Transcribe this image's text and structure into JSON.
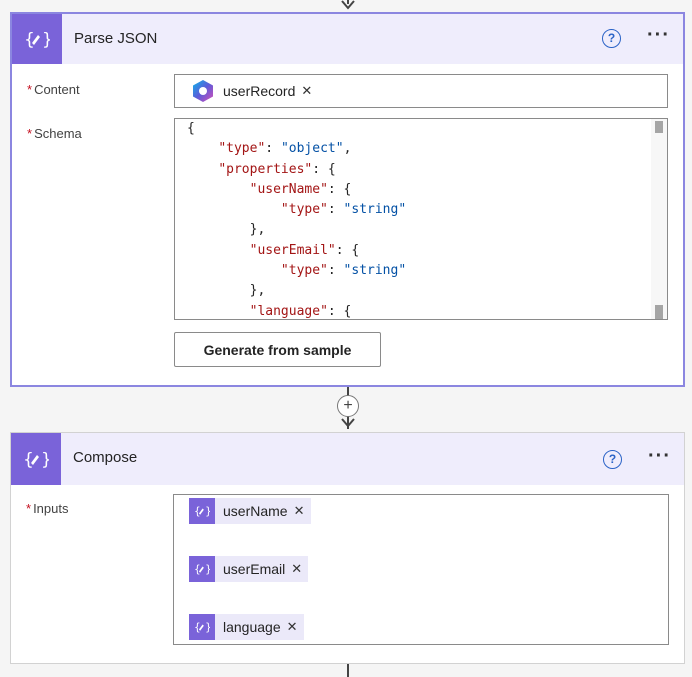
{
  "parse_json": {
    "title": "Parse JSON",
    "help": "?",
    "more": "···",
    "content_label": "Content",
    "content_token": "userRecord",
    "schema_label": "Schema",
    "schema_lines": [
      [
        {
          "t": "p",
          "v": "{"
        }
      ],
      [
        {
          "t": "p",
          "v": "    "
        },
        {
          "t": "k",
          "v": "\"type\""
        },
        {
          "t": "p",
          "v": ": "
        },
        {
          "t": "s",
          "v": "\"object\""
        },
        {
          "t": "p",
          "v": ","
        }
      ],
      [
        {
          "t": "p",
          "v": "    "
        },
        {
          "t": "k",
          "v": "\"properties\""
        },
        {
          "t": "p",
          "v": ": {"
        }
      ],
      [
        {
          "t": "p",
          "v": "        "
        },
        {
          "t": "k",
          "v": "\"userName\""
        },
        {
          "t": "p",
          "v": ": {"
        }
      ],
      [
        {
          "t": "p",
          "v": "            "
        },
        {
          "t": "k",
          "v": "\"type\""
        },
        {
          "t": "p",
          "v": ": "
        },
        {
          "t": "s",
          "v": "\"string\""
        }
      ],
      [
        {
          "t": "p",
          "v": "        },"
        }
      ],
      [
        {
          "t": "p",
          "v": "        "
        },
        {
          "t": "k",
          "v": "\"userEmail\""
        },
        {
          "t": "p",
          "v": ": {"
        }
      ],
      [
        {
          "t": "p",
          "v": "            "
        },
        {
          "t": "k",
          "v": "\"type\""
        },
        {
          "t": "p",
          "v": ": "
        },
        {
          "t": "s",
          "v": "\"string\""
        }
      ],
      [
        {
          "t": "p",
          "v": "        },"
        }
      ],
      [
        {
          "t": "p",
          "v": "        "
        },
        {
          "t": "k",
          "v": "\"language\""
        },
        {
          "t": "p",
          "v": ": {"
        }
      ]
    ],
    "generate_button": "Generate from sample"
  },
  "compose": {
    "title": "Compose",
    "help": "?",
    "more": "···",
    "inputs_label": "Inputs",
    "tokens": [
      "userName",
      "userEmail",
      "language"
    ]
  },
  "required_mark": "*",
  "remove_mark": "✕",
  "add_step": "+",
  "colors": {
    "accent": "#7a63d9",
    "selected_border": "#8b86e0",
    "header_bg": "#efedfc",
    "required": "#c50f1f"
  }
}
